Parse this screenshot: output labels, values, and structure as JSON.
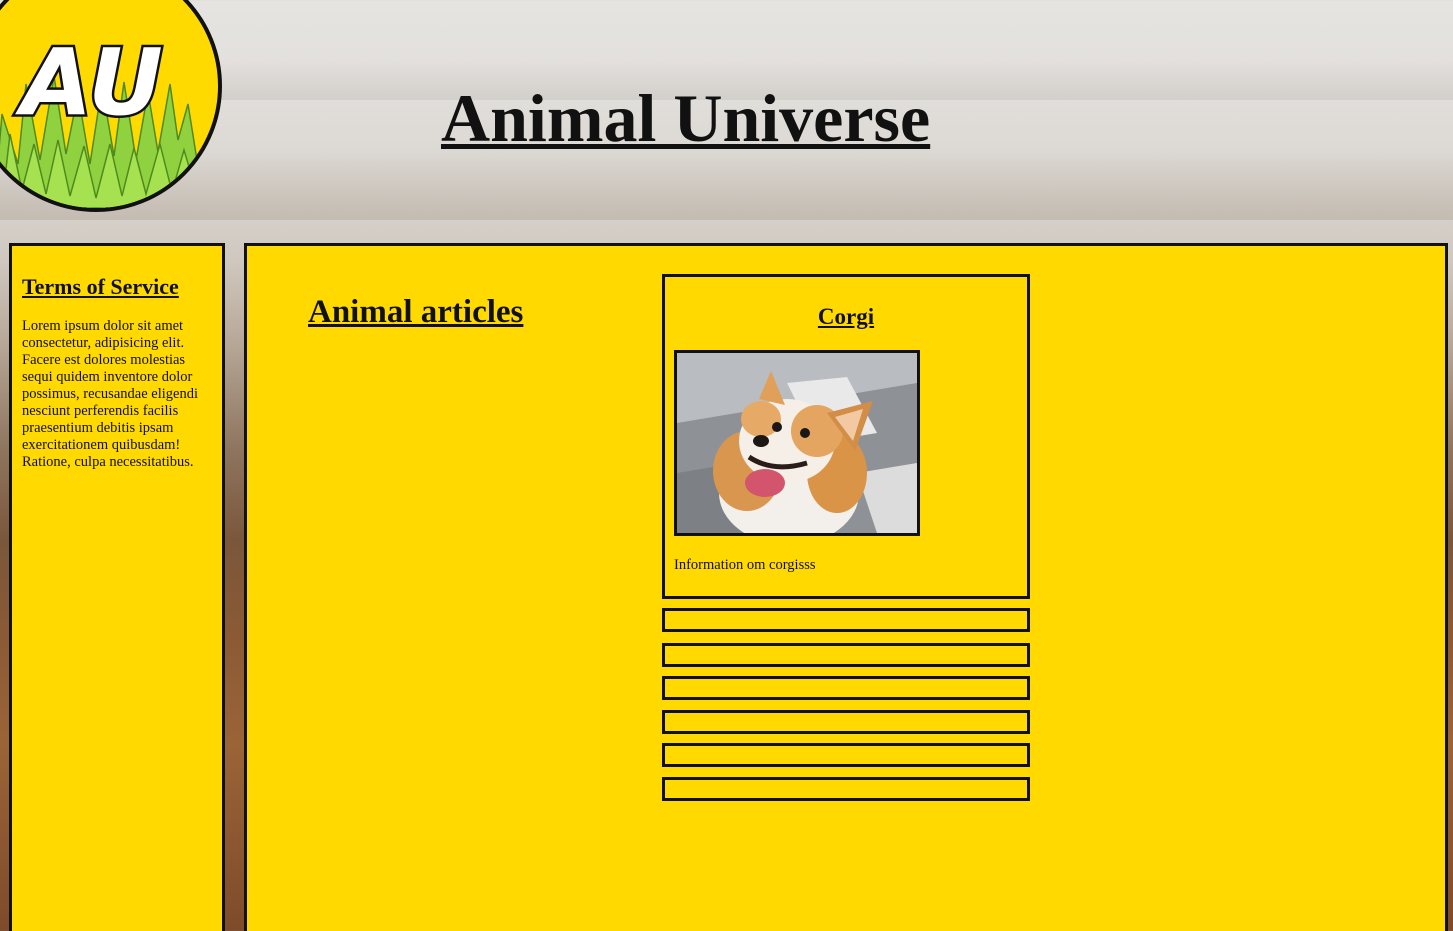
{
  "header": {
    "logo_text": "AU",
    "title": "Animal Universe"
  },
  "sidebar": {
    "heading": "Terms of Service",
    "body": "Lorem ipsum dolor sit amet consectetur, adipisicing elit. Facere est dolores molestias sequi quidem inventore dolor possimus, recusandae eligendi nesciunt perferendis facilis praesentium debitis ipsam exercitationem quibusdam! Ratione, culpa necessitatibus."
  },
  "main": {
    "section_title": "Animal articles",
    "articles": [
      {
        "title": "Corgi",
        "image_subject": "corgi dog photo",
        "description": "Information om corgisss"
      }
    ],
    "empty_article_count": 6
  },
  "colors": {
    "panel_background": "#ffd900",
    "border": "#111111",
    "logo_grass": "#8fd13f"
  }
}
